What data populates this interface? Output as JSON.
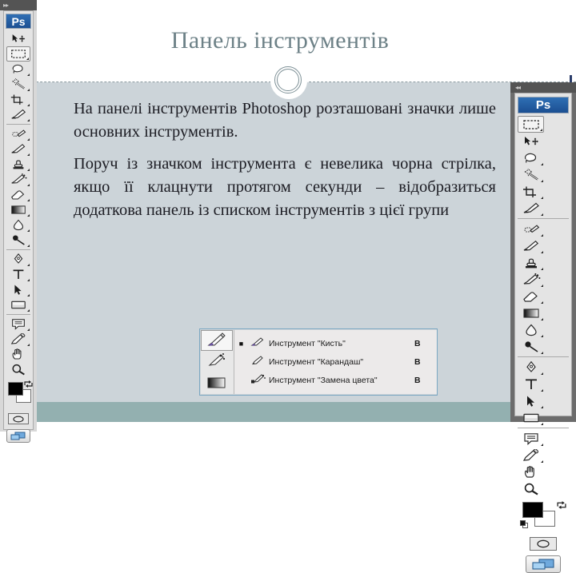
{
  "slide": {
    "title": "Панель інструментів",
    "paragraphs": [
      "На панелі інструментів Photoshop розташовані значки лише основних інструментів.",
      "Поруч із значком інструмента є невелика чорна стрілка, якщо її клацнути протягом секунди – відобразиться додаткова панель із списком інструментів з цієї групи"
    ],
    "colors": {
      "title": "#6d8187",
      "body_background": "#ccd4d9",
      "footer_band": "#93b0b0",
      "divider": "#8b9aa0",
      "accent_tick": "#2b3d6b"
    }
  },
  "flyout": {
    "border_color": "#7aa7c2",
    "column_tools": [
      {
        "name": "brush-tool",
        "selected": true
      },
      {
        "name": "color-replacement-tool",
        "selected": false
      },
      {
        "name": "gradient-tool",
        "selected": false
      }
    ],
    "rows": [
      {
        "bullet": "■",
        "icon": "brush-icon",
        "label": "Инструмент \"Кисть\"",
        "shortcut": "B"
      },
      {
        "bullet": "",
        "icon": "pencil-icon",
        "label": "Инструмент \"Карандаш\"",
        "shortcut": "B"
      },
      {
        "bullet": "",
        "icon": "color-replacement-icon",
        "label": "Инструмент \"Замена цвета\"",
        "shortcut": "B"
      }
    ]
  },
  "panel_left": {
    "collapse_arrows": "▸▸",
    "logo_text": "Ps",
    "groups": [
      {
        "tools": [
          {
            "name": "move-tool",
            "icon": "move",
            "has_flyout": false
          },
          {
            "name": "rectangular-marquee",
            "icon": "marquee",
            "has_flyout": true,
            "selected": true
          },
          {
            "name": "lasso-tool",
            "icon": "lasso",
            "has_flyout": true
          },
          {
            "name": "magic-wand-tool",
            "icon": "wand",
            "has_flyout": true
          },
          {
            "name": "crop-tool",
            "icon": "crop",
            "has_flyout": true
          },
          {
            "name": "slice-tool",
            "icon": "slice",
            "has_flyout": true
          }
        ]
      },
      {
        "tools": [
          {
            "name": "healing-brush-tool",
            "icon": "heal",
            "has_flyout": true
          },
          {
            "name": "brush-tool",
            "icon": "brush",
            "has_flyout": true
          },
          {
            "name": "clone-stamp-tool",
            "icon": "stamp",
            "has_flyout": true
          },
          {
            "name": "history-brush-tool",
            "icon": "historybrush",
            "has_flyout": true
          },
          {
            "name": "eraser-tool",
            "icon": "eraser",
            "has_flyout": true
          },
          {
            "name": "gradient-tool",
            "icon": "gradient",
            "has_flyout": true
          },
          {
            "name": "blur-tool",
            "icon": "blur",
            "has_flyout": true
          },
          {
            "name": "dodge-tool",
            "icon": "dodge",
            "has_flyout": true
          }
        ]
      },
      {
        "tools": [
          {
            "name": "pen-tool",
            "icon": "pen",
            "has_flyout": true
          },
          {
            "name": "type-tool",
            "icon": "type",
            "has_flyout": true
          },
          {
            "name": "path-selection-tool",
            "icon": "pathselect",
            "has_flyout": true
          },
          {
            "name": "rectangle-tool",
            "icon": "rectangle",
            "has_flyout": true
          }
        ]
      },
      {
        "tools": [
          {
            "name": "notes-tool",
            "icon": "notes",
            "has_flyout": true
          },
          {
            "name": "eyedropper-tool",
            "icon": "eyedropper",
            "has_flyout": true
          },
          {
            "name": "hand-tool",
            "icon": "hand",
            "has_flyout": false
          },
          {
            "name": "zoom-tool",
            "icon": "zoom",
            "has_flyout": false
          }
        ]
      }
    ],
    "default_colors_icon": "default-colors-icon",
    "swap_colors_icon": "swap-colors-icon",
    "foreground_color": "#000000",
    "background_color": "#ffffff",
    "quick_mask_icon": "quick-mask-icon",
    "screen_mode_icon": "screen-mode-icon"
  },
  "panel_right": {
    "collapse_arrows": "◂◂",
    "logo_text": "Ps",
    "groups": [
      {
        "tools": [
          {
            "name": "rectangular-marquee",
            "icon": "marquee",
            "has_flyout": true,
            "selected": true
          },
          {
            "name": "move-tool",
            "icon": "move",
            "has_flyout": false
          },
          {
            "name": "lasso-tool",
            "icon": "lasso",
            "has_flyout": true
          },
          {
            "name": "magic-wand-tool",
            "icon": "wand",
            "has_flyout": true
          },
          {
            "name": "crop-tool",
            "icon": "crop",
            "has_flyout": true
          },
          {
            "name": "slice-tool",
            "icon": "slice",
            "has_flyout": true
          }
        ]
      },
      {
        "tools": [
          {
            "name": "healing-brush-tool",
            "icon": "heal",
            "has_flyout": true
          },
          {
            "name": "brush-tool",
            "icon": "brush",
            "has_flyout": true
          },
          {
            "name": "clone-stamp-tool",
            "icon": "stamp",
            "has_flyout": true
          },
          {
            "name": "history-brush-tool",
            "icon": "historybrush",
            "has_flyout": true
          },
          {
            "name": "eraser-tool",
            "icon": "eraser",
            "has_flyout": true
          },
          {
            "name": "gradient-tool",
            "icon": "gradient",
            "has_flyout": true
          },
          {
            "name": "blur-tool",
            "icon": "blur",
            "has_flyout": true
          },
          {
            "name": "dodge-tool",
            "icon": "dodge",
            "has_flyout": true
          }
        ]
      },
      {
        "tools": [
          {
            "name": "pen-tool",
            "icon": "pen",
            "has_flyout": true
          },
          {
            "name": "type-tool",
            "icon": "type",
            "has_flyout": true
          },
          {
            "name": "path-selection-tool",
            "icon": "pathselect",
            "has_flyout": true
          },
          {
            "name": "rectangle-tool",
            "icon": "rectangle",
            "has_flyout": true
          }
        ]
      },
      {
        "tools": [
          {
            "name": "notes-tool",
            "icon": "notes",
            "has_flyout": true
          },
          {
            "name": "eyedropper-tool",
            "icon": "eyedropper",
            "has_flyout": true
          },
          {
            "name": "hand-tool",
            "icon": "hand",
            "has_flyout": false
          },
          {
            "name": "zoom-tool",
            "icon": "zoom",
            "has_flyout": false
          }
        ]
      }
    ],
    "foreground_color": "#000000",
    "background_color": "#ffffff",
    "quick_mask_icon": "quick-mask-icon",
    "screen_mode_icon": "screen-mode-icon"
  }
}
